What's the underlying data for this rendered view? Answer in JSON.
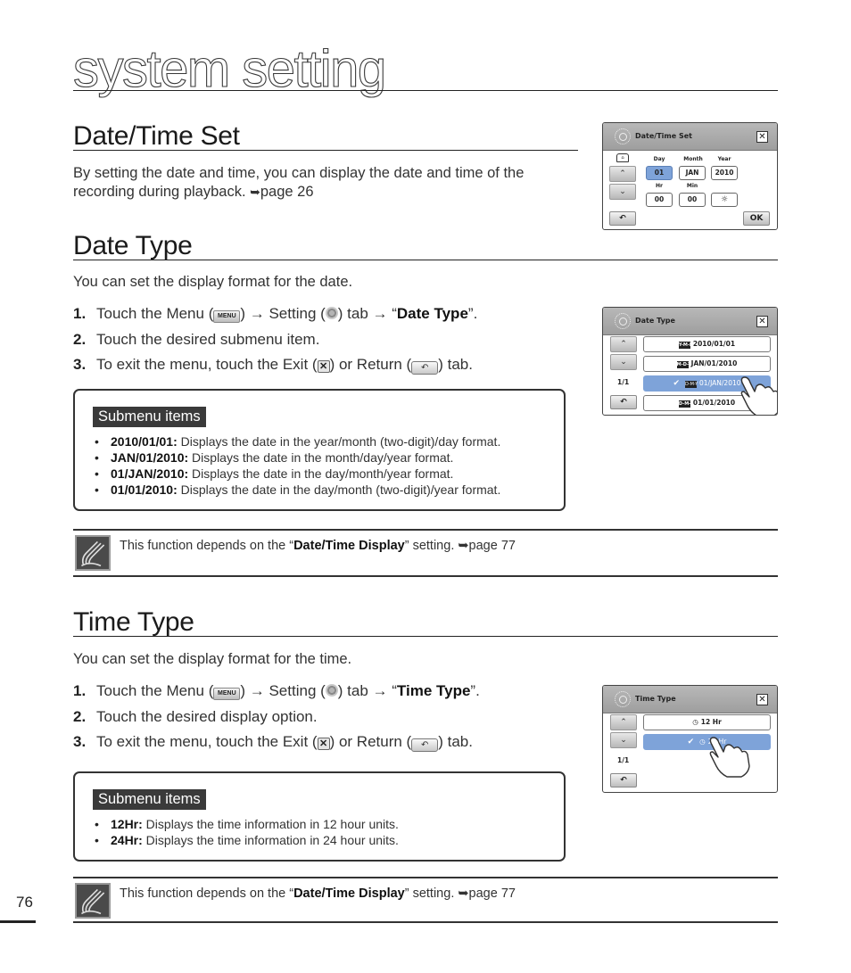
{
  "chapter": {
    "title": "system setting"
  },
  "sections": {
    "date_time_set": {
      "heading": "Date/Time Set",
      "body": "By setting the date and time, you can display the date and time of the recording during playback.",
      "ref_arrow": "➥",
      "ref": "page 26"
    },
    "date_type": {
      "heading": "Date Type",
      "intro": "You can set the display format for the date.",
      "steps": [
        {
          "num": "1.",
          "pre": "Touch the Menu (",
          "menu_icon": "MENU",
          "mid1": ") → Setting (",
          "mid2": ") tab → “",
          "bold": "Date Type",
          "post": "”."
        },
        {
          "num": "2.",
          "text": "Touch the desired submenu item."
        },
        {
          "num": "3.",
          "pre": "To exit the menu, touch the Exit (",
          "mid": ") or Return (",
          "post": ") tab."
        }
      ],
      "submenu": {
        "tag": "Submenu items",
        "items": [
          {
            "term": "2010/01/01:",
            "desc": " Displays the date in the year/month (two-digit)/day format."
          },
          {
            "term": "JAN/01/2010:",
            "desc": " Displays the date in the month/day/year format."
          },
          {
            "term": "01/JAN/2010:",
            "desc": " Displays the date in the day/month/year format."
          },
          {
            "term": "01/01/2010:",
            "desc": " Displays the date in the day/month (two-digit)/year format."
          }
        ]
      },
      "note": {
        "pre": "This function depends on the “",
        "bold": "Date/Time Display",
        "post": "” setting. ",
        "arrow": "➥",
        "ref": "page 77"
      }
    },
    "time_type": {
      "heading": "Time Type",
      "intro": "You can set the display format for the time.",
      "steps": [
        {
          "num": "1.",
          "pre": "Touch the Menu (",
          "menu_icon": "MENU",
          "mid1": ") → Setting (",
          "mid2": ") tab → “",
          "bold": "Time Type",
          "post": "”."
        },
        {
          "num": "2.",
          "text": "Touch the desired display option."
        },
        {
          "num": "3.",
          "pre": "To exit the menu, touch the Exit (",
          "mid": ") or Return (",
          "post": ") tab."
        }
      ],
      "submenu": {
        "tag": "Submenu items",
        "items": [
          {
            "term": "12Hr:",
            "desc": " Displays the time information in 12 hour units."
          },
          {
            "term": "24Hr:",
            "desc": " Displays the time information in 24 hour units."
          }
        ]
      },
      "note": {
        "pre": "This function depends on the “",
        "bold": "Date/Time Display",
        "post": "” setting. ",
        "arrow": "➥",
        "ref": "page 77"
      }
    }
  },
  "screens": {
    "date_time_set": {
      "title": "Date/Time Set",
      "labels": {
        "day": "Day",
        "month": "Month",
        "year": "Year",
        "hr": "Hr",
        "min": "Min"
      },
      "values": {
        "day": "01",
        "month": "JAN",
        "year": "2010",
        "hr": "00",
        "min": "00"
      },
      "ok": "OK",
      "selected_field": "day"
    },
    "date_type": {
      "title": "Date Type",
      "page": "1/1",
      "options": [
        {
          "fmt": "Y-M-D",
          "label": "2010/01/01",
          "selected": false
        },
        {
          "fmt": "M-D-Y",
          "label": "JAN/01/2010",
          "selected": false
        },
        {
          "fmt": "D-M-Y",
          "label": "01/JAN/2010",
          "selected": true
        },
        {
          "fmt": "D-M-Y",
          "label": "01/01/2010",
          "selected": false
        }
      ],
      "check": "✔"
    },
    "time_type": {
      "title": "Time Type",
      "page": "1/1",
      "options": [
        {
          "label": "12 Hr",
          "selected": false
        },
        {
          "label": "24 Hr",
          "selected": true
        }
      ],
      "check": "✔"
    }
  },
  "icons": {
    "close": "✕",
    "up": "⌃",
    "down": "⌄",
    "return": "↶",
    "exit": "✕"
  },
  "colors": {
    "selected_blue": "#7ea3d9",
    "tag_bg": "#3a3a3a"
  },
  "page_number": "76"
}
